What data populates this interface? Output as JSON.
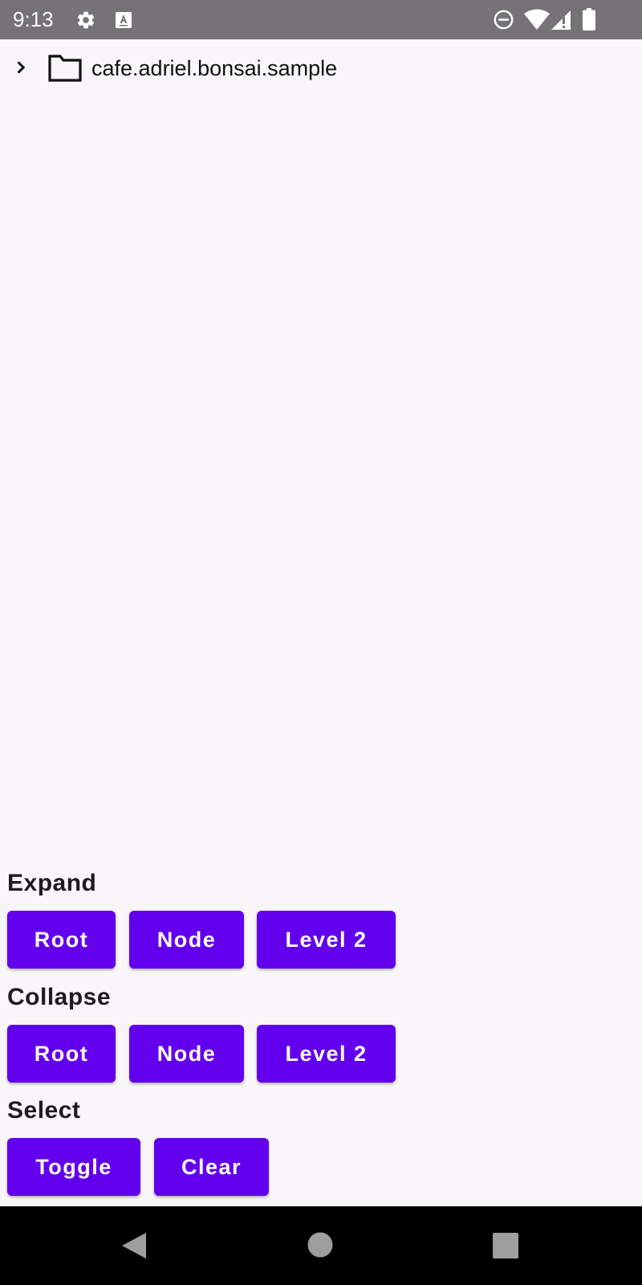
{
  "status_bar": {
    "time": "9:13",
    "icons": [
      "settings-icon",
      "accessibility-a-icon",
      "do-not-disturb-icon",
      "wifi-icon",
      "signal-icon",
      "battery-icon"
    ],
    "background": "#757376"
  },
  "tree": {
    "root_label": "cafe.adriel.bonsai.sample",
    "root_expanded": false,
    "icons": [
      "chevron-right-icon",
      "folder-icon"
    ]
  },
  "sections": {
    "expand": {
      "title": "Expand",
      "buttons": [
        "Root",
        "Node",
        "Level 2"
      ]
    },
    "collapse": {
      "title": "Collapse",
      "buttons": [
        "Root",
        "Node",
        "Level 2"
      ]
    },
    "select": {
      "title": "Select",
      "buttons": [
        "Toggle",
        "Clear"
      ]
    }
  },
  "nav_bar": {
    "icons": [
      "back-icon",
      "home-icon",
      "recents-icon"
    ]
  },
  "colors": {
    "accent": "#6200ee",
    "background": "#f8f6f9",
    "nav_bar": "#000000"
  }
}
